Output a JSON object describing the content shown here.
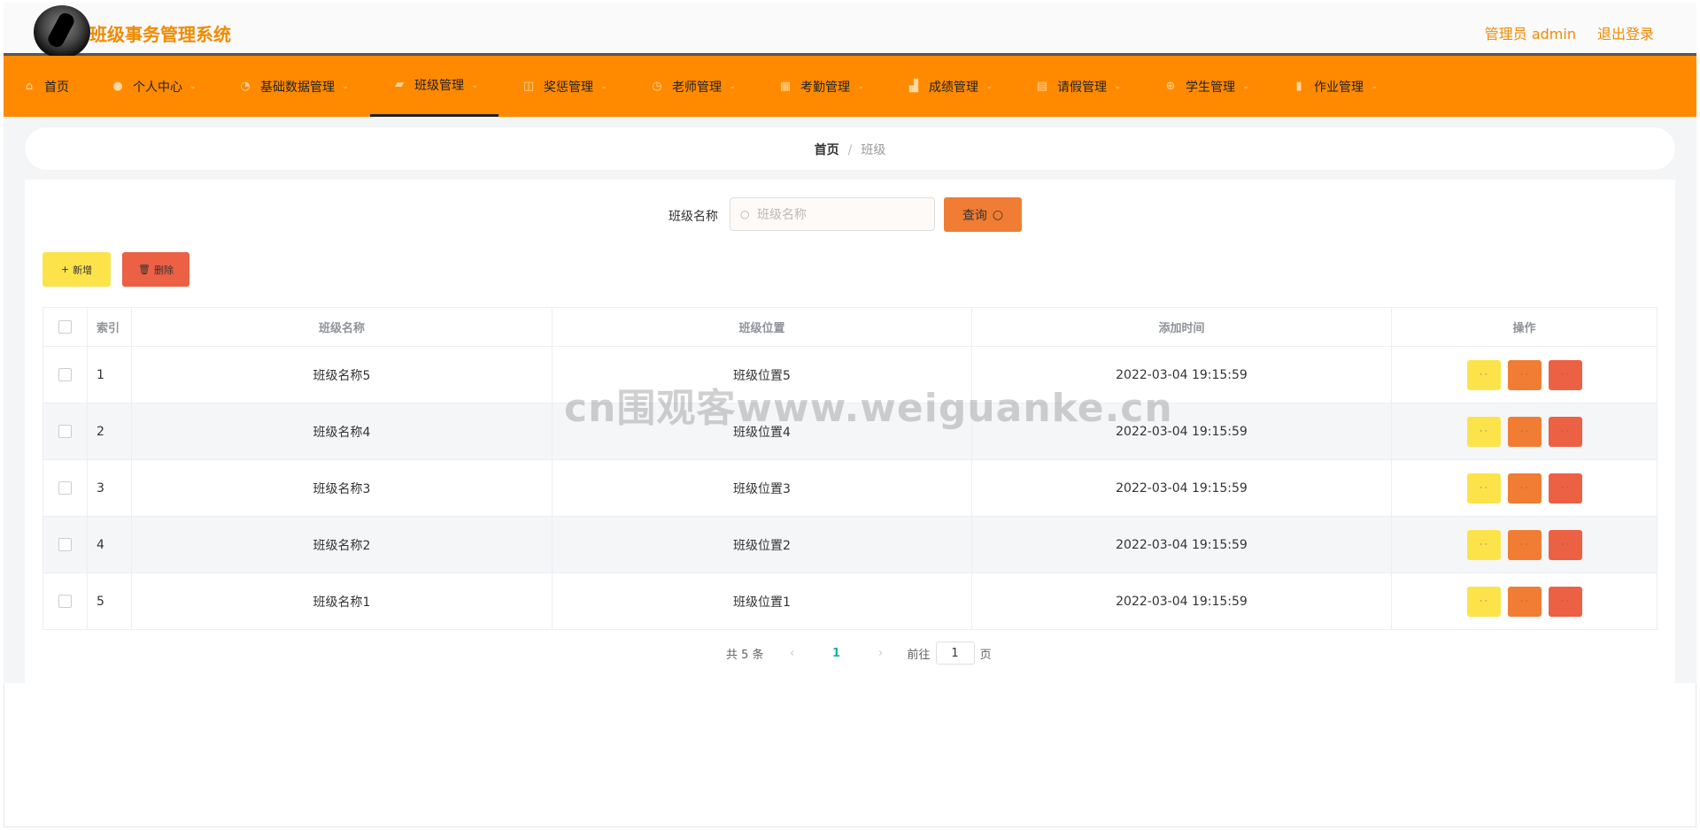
{
  "app": {
    "title": "班级事务管理系统"
  },
  "topbar": {
    "user_label": "管理员 admin",
    "logout_label": "退出登录"
  },
  "nav": {
    "items": [
      {
        "label": "首页",
        "icon": "home-icon"
      },
      {
        "label": "个人中心",
        "icon": "user-icon"
      },
      {
        "label": "基础数据管理",
        "icon": "dashboard-icon"
      },
      {
        "label": "班级管理",
        "icon": "class-icon"
      },
      {
        "label": "奖惩管理",
        "icon": "award-icon"
      },
      {
        "label": "老师管理",
        "icon": "clock-icon"
      },
      {
        "label": "考勤管理",
        "icon": "calendar-icon"
      },
      {
        "label": "成绩管理",
        "icon": "score-icon"
      },
      {
        "label": "请假管理",
        "icon": "leave-icon"
      },
      {
        "label": "学生管理",
        "icon": "target-icon"
      },
      {
        "label": "作业管理",
        "icon": "chart-icon"
      }
    ],
    "active": "班级管理"
  },
  "breadcrumb": {
    "home": "首页",
    "separator": "/",
    "current": "班级"
  },
  "search": {
    "label": "班级名称",
    "placeholder": "班级名称",
    "value": "",
    "button_label": "查询"
  },
  "actions": {
    "add_label": "新增",
    "delete_label": "删除"
  },
  "table": {
    "headers": [
      "索引",
      "班级名称",
      "班级位置",
      "添加时间",
      "操作"
    ],
    "rows": [
      {
        "index": "1",
        "name": "班级名称5",
        "location": "班级位置5",
        "time": "2022-03-04 19:15:59"
      },
      {
        "index": "2",
        "name": "班级名称4",
        "location": "班级位置4",
        "time": "2022-03-04 19:15:59"
      },
      {
        "index": "3",
        "name": "班级名称3",
        "location": "班级位置3",
        "time": "2022-03-04 19:15:59"
      },
      {
        "index": "4",
        "name": "班级名称2",
        "location": "班级位置2",
        "time": "2022-03-04 19:15:59"
      },
      {
        "index": "5",
        "name": "班级名称1",
        "location": "班级位置1",
        "time": "2022-03-04 19:15:59"
      }
    ],
    "op_labels": {
      "detail": "· ·",
      "edit": "· ·",
      "delete": "· ·"
    }
  },
  "pagination": {
    "total_label": "共 5 条",
    "current_page": "1",
    "goto_label": "前往",
    "goto_value": "1",
    "page_suffix": "页"
  },
  "watermark": "cn围观客www.weiguanke.cn",
  "colors": {
    "accent": "#ff8a00",
    "title": "#f08a00",
    "yellow": "#fde34a",
    "orange": "#f07d33",
    "red": "#ec6044",
    "page_active": "#16b39e"
  }
}
